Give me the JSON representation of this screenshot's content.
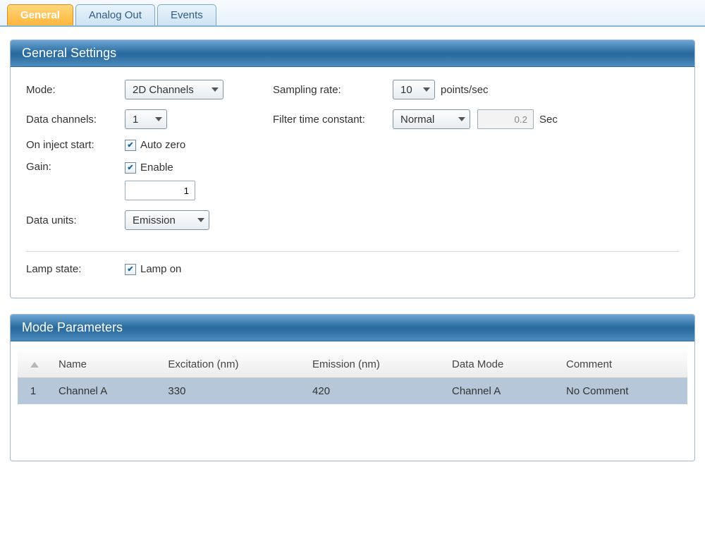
{
  "tabs": {
    "general": "General",
    "analog_out": "Analog Out",
    "events": "Events"
  },
  "general_settings": {
    "title": "General Settings",
    "mode_label": "Mode:",
    "mode_value": "2D Channels",
    "data_channels_label": "Data channels:",
    "data_channels_value": "1",
    "on_inject_start_label": "On inject start:",
    "auto_zero_checked": true,
    "auto_zero_label": "Auto zero",
    "gain_label": "Gain:",
    "gain_enable_checked": true,
    "gain_enable_label": "Enable",
    "gain_value": "1",
    "data_units_label": "Data units:",
    "data_units_value": "Emission",
    "lamp_state_label": "Lamp state:",
    "lamp_on_checked": true,
    "lamp_on_label": "Lamp on",
    "sampling_rate_label": "Sampling rate:",
    "sampling_rate_value": "10",
    "sampling_rate_unit": "points/sec",
    "filter_time_constant_label": "Filter time constant:",
    "filter_time_constant_value": "Normal",
    "filter_seconds_value": "0.2",
    "filter_seconds_unit": "Sec"
  },
  "mode_parameters": {
    "title": "Mode Parameters",
    "columns": {
      "name": "Name",
      "excitation": "Excitation (nm)",
      "emission": "Emission (nm)",
      "data_mode": "Data Mode",
      "comment": "Comment"
    },
    "rows": [
      {
        "index": "1",
        "name": "Channel A",
        "excitation": "330",
        "emission": "420",
        "data_mode": "Channel A",
        "comment": "No Comment"
      }
    ]
  }
}
